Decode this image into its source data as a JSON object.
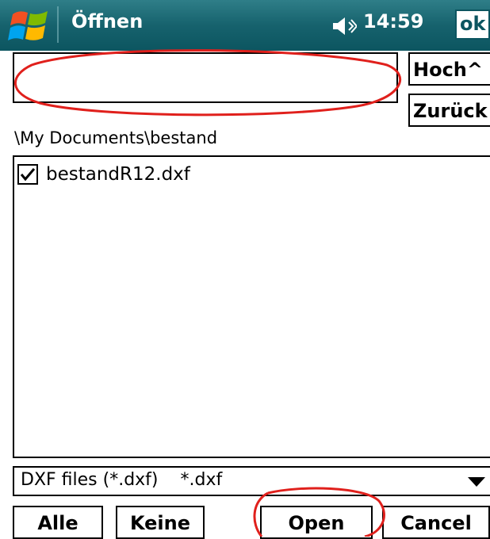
{
  "titlebar": {
    "title": "Öffnen",
    "clock": "14:59",
    "ok_label": "ok",
    "start_icon": "windows-logo-icon",
    "volume_icon": "speaker-icon"
  },
  "dialog": {
    "filename_value": "",
    "hoch_label": "Hoch^",
    "zurueck_label": "Zurück",
    "path": "\\My Documents\\bestand",
    "files": [
      {
        "name": "bestandR12.dxf",
        "checked": true
      }
    ],
    "filter": {
      "selected": "DXF files (*.dxf)    *.dxf"
    },
    "buttons": {
      "alle": "Alle",
      "keine": "Keine",
      "open": "Open",
      "cancel": "Cancel"
    }
  },
  "colors": {
    "titlebar": "#16626d",
    "annotation": "#e0201c"
  }
}
